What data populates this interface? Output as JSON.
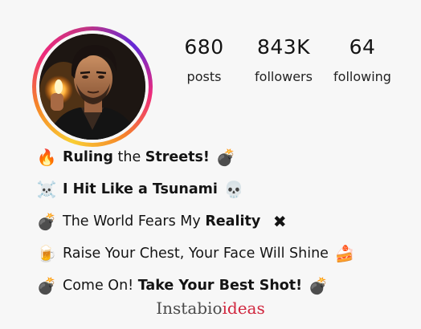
{
  "profile": {
    "stats": [
      {
        "value": "680",
        "label": "posts"
      },
      {
        "value": "843K",
        "label": "followers"
      },
      {
        "value": "64",
        "label": "following"
      }
    ]
  },
  "bio": {
    "line1": {
      "emoji_start": "🔥",
      "t1": "Ruling",
      "t2": " the ",
      "t3": "Streets!",
      "emoji_end": "💣"
    },
    "line2": {
      "emoji_start": "☠️",
      "t1": "I Hit Like a Tsunami",
      "emoji_end": "💀"
    },
    "line3": {
      "emoji_start": "💣",
      "t1": "The World Fears My ",
      "t2": "Reality",
      "emoji_end": "✖"
    },
    "line4": {
      "emoji_start": "🍺",
      "t1": "Raise Your Chest, Your Face Will Shine",
      "emoji_end": "🍰"
    },
    "line5": {
      "emoji_start": "💣",
      "t1": "Come On! ",
      "t2": "Take Your Best Shot!",
      "emoji_end": "💣"
    }
  },
  "brand": {
    "part1": "Instabio",
    "part2": "ideas",
    "color_part2": "#d0253d"
  }
}
